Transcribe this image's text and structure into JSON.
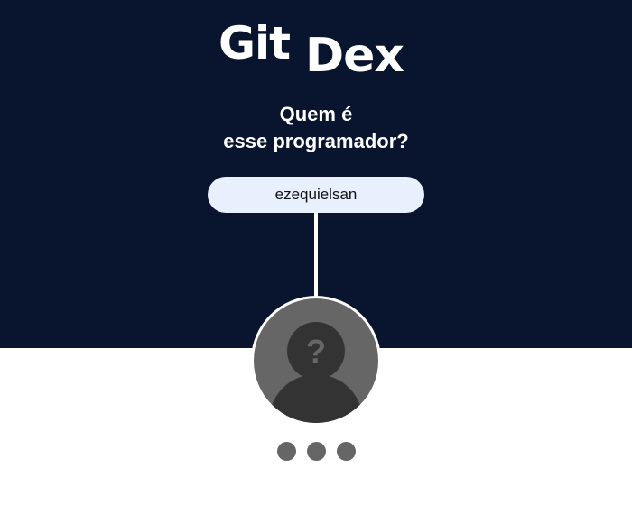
{
  "brand": {
    "logo_part1": "Git",
    "logo_part2": "Dex"
  },
  "prompt": {
    "line1": "Quem é",
    "line2": "esse programador?"
  },
  "search": {
    "value": "ezequielsan"
  },
  "avatar": {
    "icon": "unknown-user-icon",
    "symbol": "?"
  },
  "loading": {
    "dot_count": 3
  },
  "colors": {
    "header_bg": "#09142e",
    "input_bg": "#e8effd",
    "avatar_bg": "#666666",
    "silhouette": "#333333",
    "dots": "#666666"
  }
}
